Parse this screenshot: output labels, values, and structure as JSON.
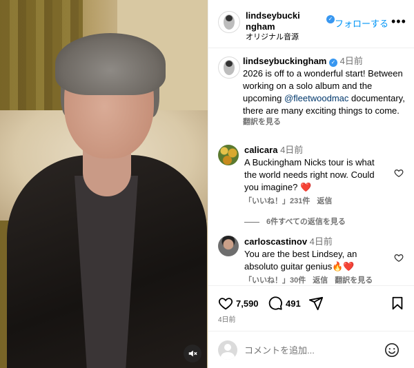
{
  "header": {
    "username": "lindseybuckingham",
    "follow_label": "フォローする",
    "audio_label": "オリジナル音源",
    "more_label": "•••"
  },
  "caption": {
    "username": "lindseybuckingham",
    "time": "4日前",
    "text_before": "2026 is off to a wonderful start! Between working on a solo album and the upcoming ",
    "mention": "@fleetwoodmac",
    "text_after": " documentary, there are many exciting things to come.",
    "translate_label": "翻訳を見る"
  },
  "comments": [
    {
      "username": "calicara",
      "time": "4日前",
      "text": "A Buckingham Nicks tour is what the world needs right now. Could you imagine? ❤️",
      "likes": "「いいね！」231件",
      "reply_label": "返信",
      "view_replies": "6件すべての返信を見る"
    },
    {
      "username": "carloscastinov",
      "time": "4日前",
      "text": "You are the best Lindsey, an absoluto guitar genius🔥❤️",
      "likes": "「いいね！」30件",
      "reply_label": "返信",
      "translate_label": "翻訳を見る"
    }
  ],
  "actions": {
    "like_count": "7,590",
    "comment_count": "491",
    "posted": "4日前"
  },
  "add_comment": {
    "placeholder": "コメントを追加..."
  },
  "colors": {
    "accent": "#0095f6",
    "verified": "#3897f0",
    "muted": "#737373",
    "mention": "#00376b"
  },
  "icons": [
    "mute-icon",
    "verified-icon",
    "more-icon",
    "heart-icon",
    "comment-icon",
    "share-icon",
    "bookmark-icon",
    "emoji-icon"
  ]
}
